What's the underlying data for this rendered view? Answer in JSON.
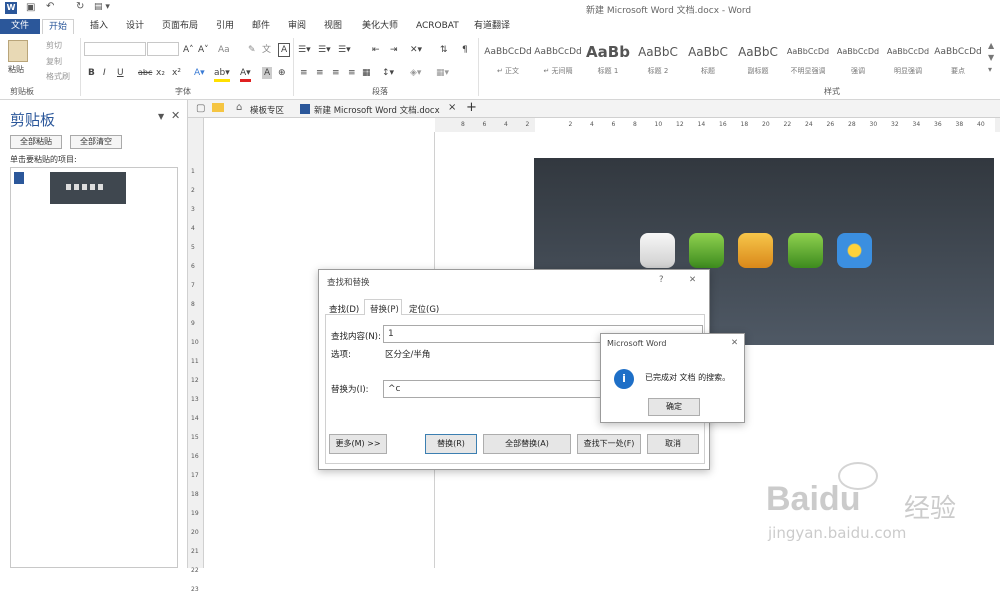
{
  "window": {
    "title": "新建 Microsoft Word 文档.docx - Word"
  },
  "ribbon_tabs": [
    "文件",
    "开始",
    "插入",
    "设计",
    "页面布局",
    "引用",
    "邮件",
    "审阅",
    "视图",
    "美化大师",
    "ACROBAT",
    "有道翻译"
  ],
  "clipboard_group": {
    "paste": "粘贴",
    "cut": "剪切",
    "copy": "复制",
    "format_painter": "格式刷",
    "label": "剪贴板"
  },
  "font_group": {
    "label": "字体",
    "bold": "B",
    "italic": "I",
    "underline": "U",
    "strike": "abc",
    "sub": "x₂",
    "sup": "x²",
    "grow": "A˄",
    "shrink": "A˅",
    "case": "Aa"
  },
  "paragraph_group": {
    "label": "段落"
  },
  "styles_group": {
    "label": "样式",
    "items": [
      {
        "sample": "AaBbCcDd",
        "name": "↵ 正文"
      },
      {
        "sample": "AaBbCcDd",
        "name": "↵ 无间隔"
      },
      {
        "sample": "AaBb",
        "name": "标题 1"
      },
      {
        "sample": "AaBbC",
        "name": "标题 2"
      },
      {
        "sample": "AaBbC",
        "name": "标题"
      },
      {
        "sample": "AaBbC",
        "name": "副标题"
      },
      {
        "sample": "AaBbCcDd",
        "name": "不明显强调"
      },
      {
        "sample": "AaBbCcDd",
        "name": "强调"
      },
      {
        "sample": "AaBbCcDd",
        "name": "明显强调"
      },
      {
        "sample": "AaBbCcDd",
        "name": "要点"
      }
    ]
  },
  "clip_pane": {
    "title": "剪贴板",
    "paste_all": "全部粘贴",
    "clear_all": "全部清空",
    "hint": "单击要粘贴的项目:"
  },
  "doc_tabs": {
    "template": "模板专区",
    "doc": "新建 Microsoft Word 文档.docx",
    "close": "×",
    "add": "+"
  },
  "hruler_ticks": [
    "8",
    "6",
    "4",
    "2",
    "",
    "2",
    "4",
    "6",
    "8",
    "10",
    "12",
    "14",
    "16",
    "18",
    "20",
    "22",
    "24",
    "26",
    "28",
    "30",
    "32",
    "34",
    "36",
    "38",
    "40"
  ],
  "vruler_ticks": [
    "1",
    "2",
    "3",
    "4",
    "5",
    "6",
    "7",
    "8",
    "9",
    "10",
    "11",
    "12",
    "13",
    "14",
    "15",
    "16",
    "17",
    "18",
    "19",
    "20",
    "21",
    "22",
    "23"
  ],
  "find_dialog": {
    "title": "查找和替换",
    "help": "?",
    "close": "✕",
    "tabs": [
      "查找(D)",
      "替换(P)",
      "定位(G)"
    ],
    "find_label": "查找内容(N):",
    "find_value": "1",
    "options_label": "选项:",
    "options_value": "区分全/半角",
    "replace_label": "替换为(I):",
    "replace_value": "^c",
    "more_btn": "更多(M) >>",
    "replace_btn": "替换(R)",
    "replace_all_btn": "全部替换(A)",
    "find_next_btn": "查找下一处(F)",
    "cancel_btn": "取消"
  },
  "msg_dialog": {
    "title": "Microsoft Word",
    "close": "✕",
    "icon": "i",
    "message": "已完成对 文档 的搜索。",
    "ok": "确定"
  },
  "watermark": {
    "brand": "Bai",
    "brand2": "du",
    "cn": "经验",
    "url": "jingyan.baidu.com"
  },
  "colors": {
    "accent": "#2b579a",
    "file_tab": "#2b579a",
    "app_blue": "#1e6fc7"
  }
}
